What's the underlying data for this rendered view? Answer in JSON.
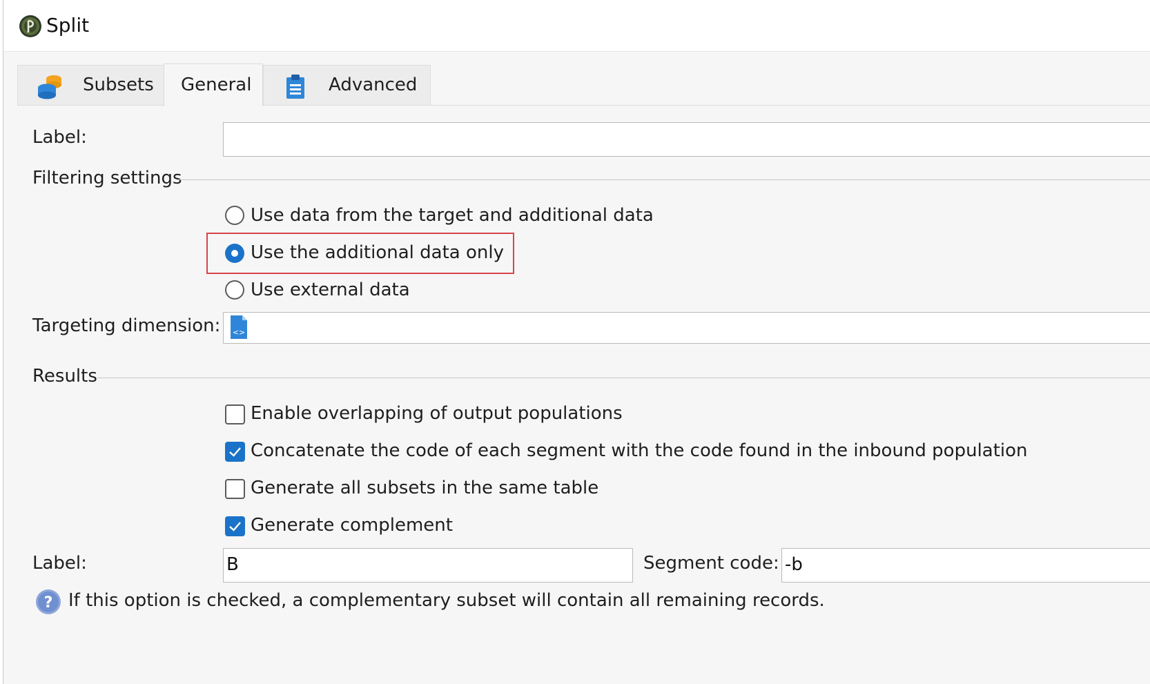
{
  "window": {
    "title": "Split",
    "app_icon": "app-logo-icon"
  },
  "tabs": [
    {
      "label": "Subsets",
      "icon": "database-stack-icon",
      "active": false
    },
    {
      "label": "General",
      "icon": "",
      "active": true
    },
    {
      "label": "Advanced",
      "icon": "clipboard-icon",
      "active": false
    }
  ],
  "form": {
    "label_field": {
      "label": "Label:",
      "value": ""
    },
    "filtering": {
      "heading": "Filtering settings",
      "options": [
        {
          "label": "Use data from the target and additional data",
          "selected": false
        },
        {
          "label": "Use the additional data only",
          "selected": true
        },
        {
          "label": "Use external data",
          "selected": false
        }
      ]
    },
    "targeting": {
      "label": "Targeting dimension:",
      "value": "",
      "icon": "schema-document-icon"
    },
    "results": {
      "heading": "Results",
      "checkboxes": [
        {
          "label": "Enable overlapping of output populations",
          "checked": false
        },
        {
          "label": "Concatenate the code of each segment with the code found in the inbound population",
          "checked": true
        },
        {
          "label": "Generate all subsets in the same table",
          "checked": false
        },
        {
          "label": "Generate complement",
          "checked": true
        }
      ]
    },
    "complement": {
      "label": "Label:",
      "label_value": "B",
      "segment_label": "Segment code:",
      "segment_value": "-b"
    },
    "help": {
      "icon": "help-icon",
      "text": "If this option is checked, a complementary subset will contain all remaining records."
    }
  },
  "colors": {
    "accent": "#1a73c8",
    "highlight": "#d9434b"
  }
}
